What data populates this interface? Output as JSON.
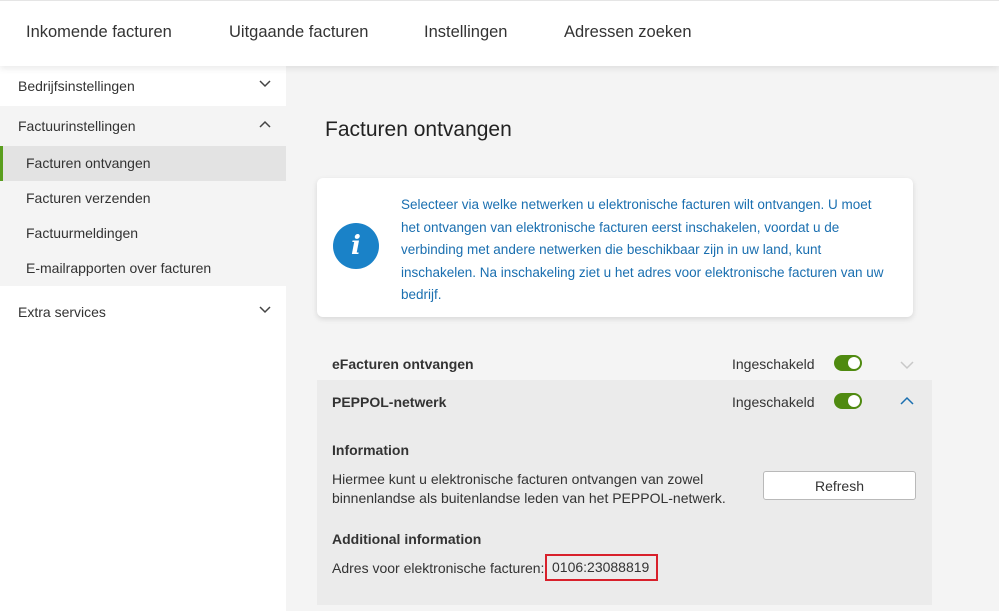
{
  "topnav": {
    "tabs": [
      {
        "label": "Inkomende facturen"
      },
      {
        "label": "Uitgaande facturen"
      },
      {
        "label": "Instellingen"
      },
      {
        "label": "Adressen zoeken"
      }
    ]
  },
  "sidebar": {
    "groups": [
      {
        "label": "Bedrijfsinstellingen",
        "state": "collapsed"
      },
      {
        "label": "Factuurinstellingen",
        "state": "expanded",
        "items": [
          {
            "label": "Facturen ontvangen",
            "active": true
          },
          {
            "label": "Facturen verzenden"
          },
          {
            "label": "Factuurmeldingen"
          },
          {
            "label": "E-mailrapporten over facturen"
          }
        ]
      },
      {
        "label": "Extra services",
        "state": "collapsed"
      }
    ]
  },
  "main": {
    "title": "Facturen ontvangen",
    "info": {
      "icon": "info-icon",
      "text": "Selecteer via welke netwerken u elektronische facturen wilt ontvangen. U moet het ontvangen van elektronische facturen eerst inschakelen, voordat u de verbinding met andere netwerken die beschikbaar zijn in uw land, kunt inschakelen. Na inschakeling ziet u het adres voor elektronische facturen van uw bedrijf."
    },
    "rows": [
      {
        "label": "eFacturen ontvangen",
        "status": "Ingeschakeld",
        "enabled": true,
        "expanded": false
      },
      {
        "label": "PEPPOL-netwerk",
        "status": "Ingeschakeld",
        "enabled": true,
        "expanded": true
      }
    ],
    "panel": {
      "info_heading": "Information",
      "description": "Hiermee kunt u elektronische facturen ontvangen van zowel binnenlandse als buitenlandse leden van het PEPPOL-netwerk.",
      "refresh_label": "Refresh",
      "additional_heading": "Additional information",
      "address_label": "Adres voor elektronische facturen:",
      "address_value": "0106:23088819"
    }
  },
  "colors": {
    "accent_green": "#4f8a10",
    "info_blue": "#1a82c8",
    "highlight_red": "#d8202b"
  }
}
